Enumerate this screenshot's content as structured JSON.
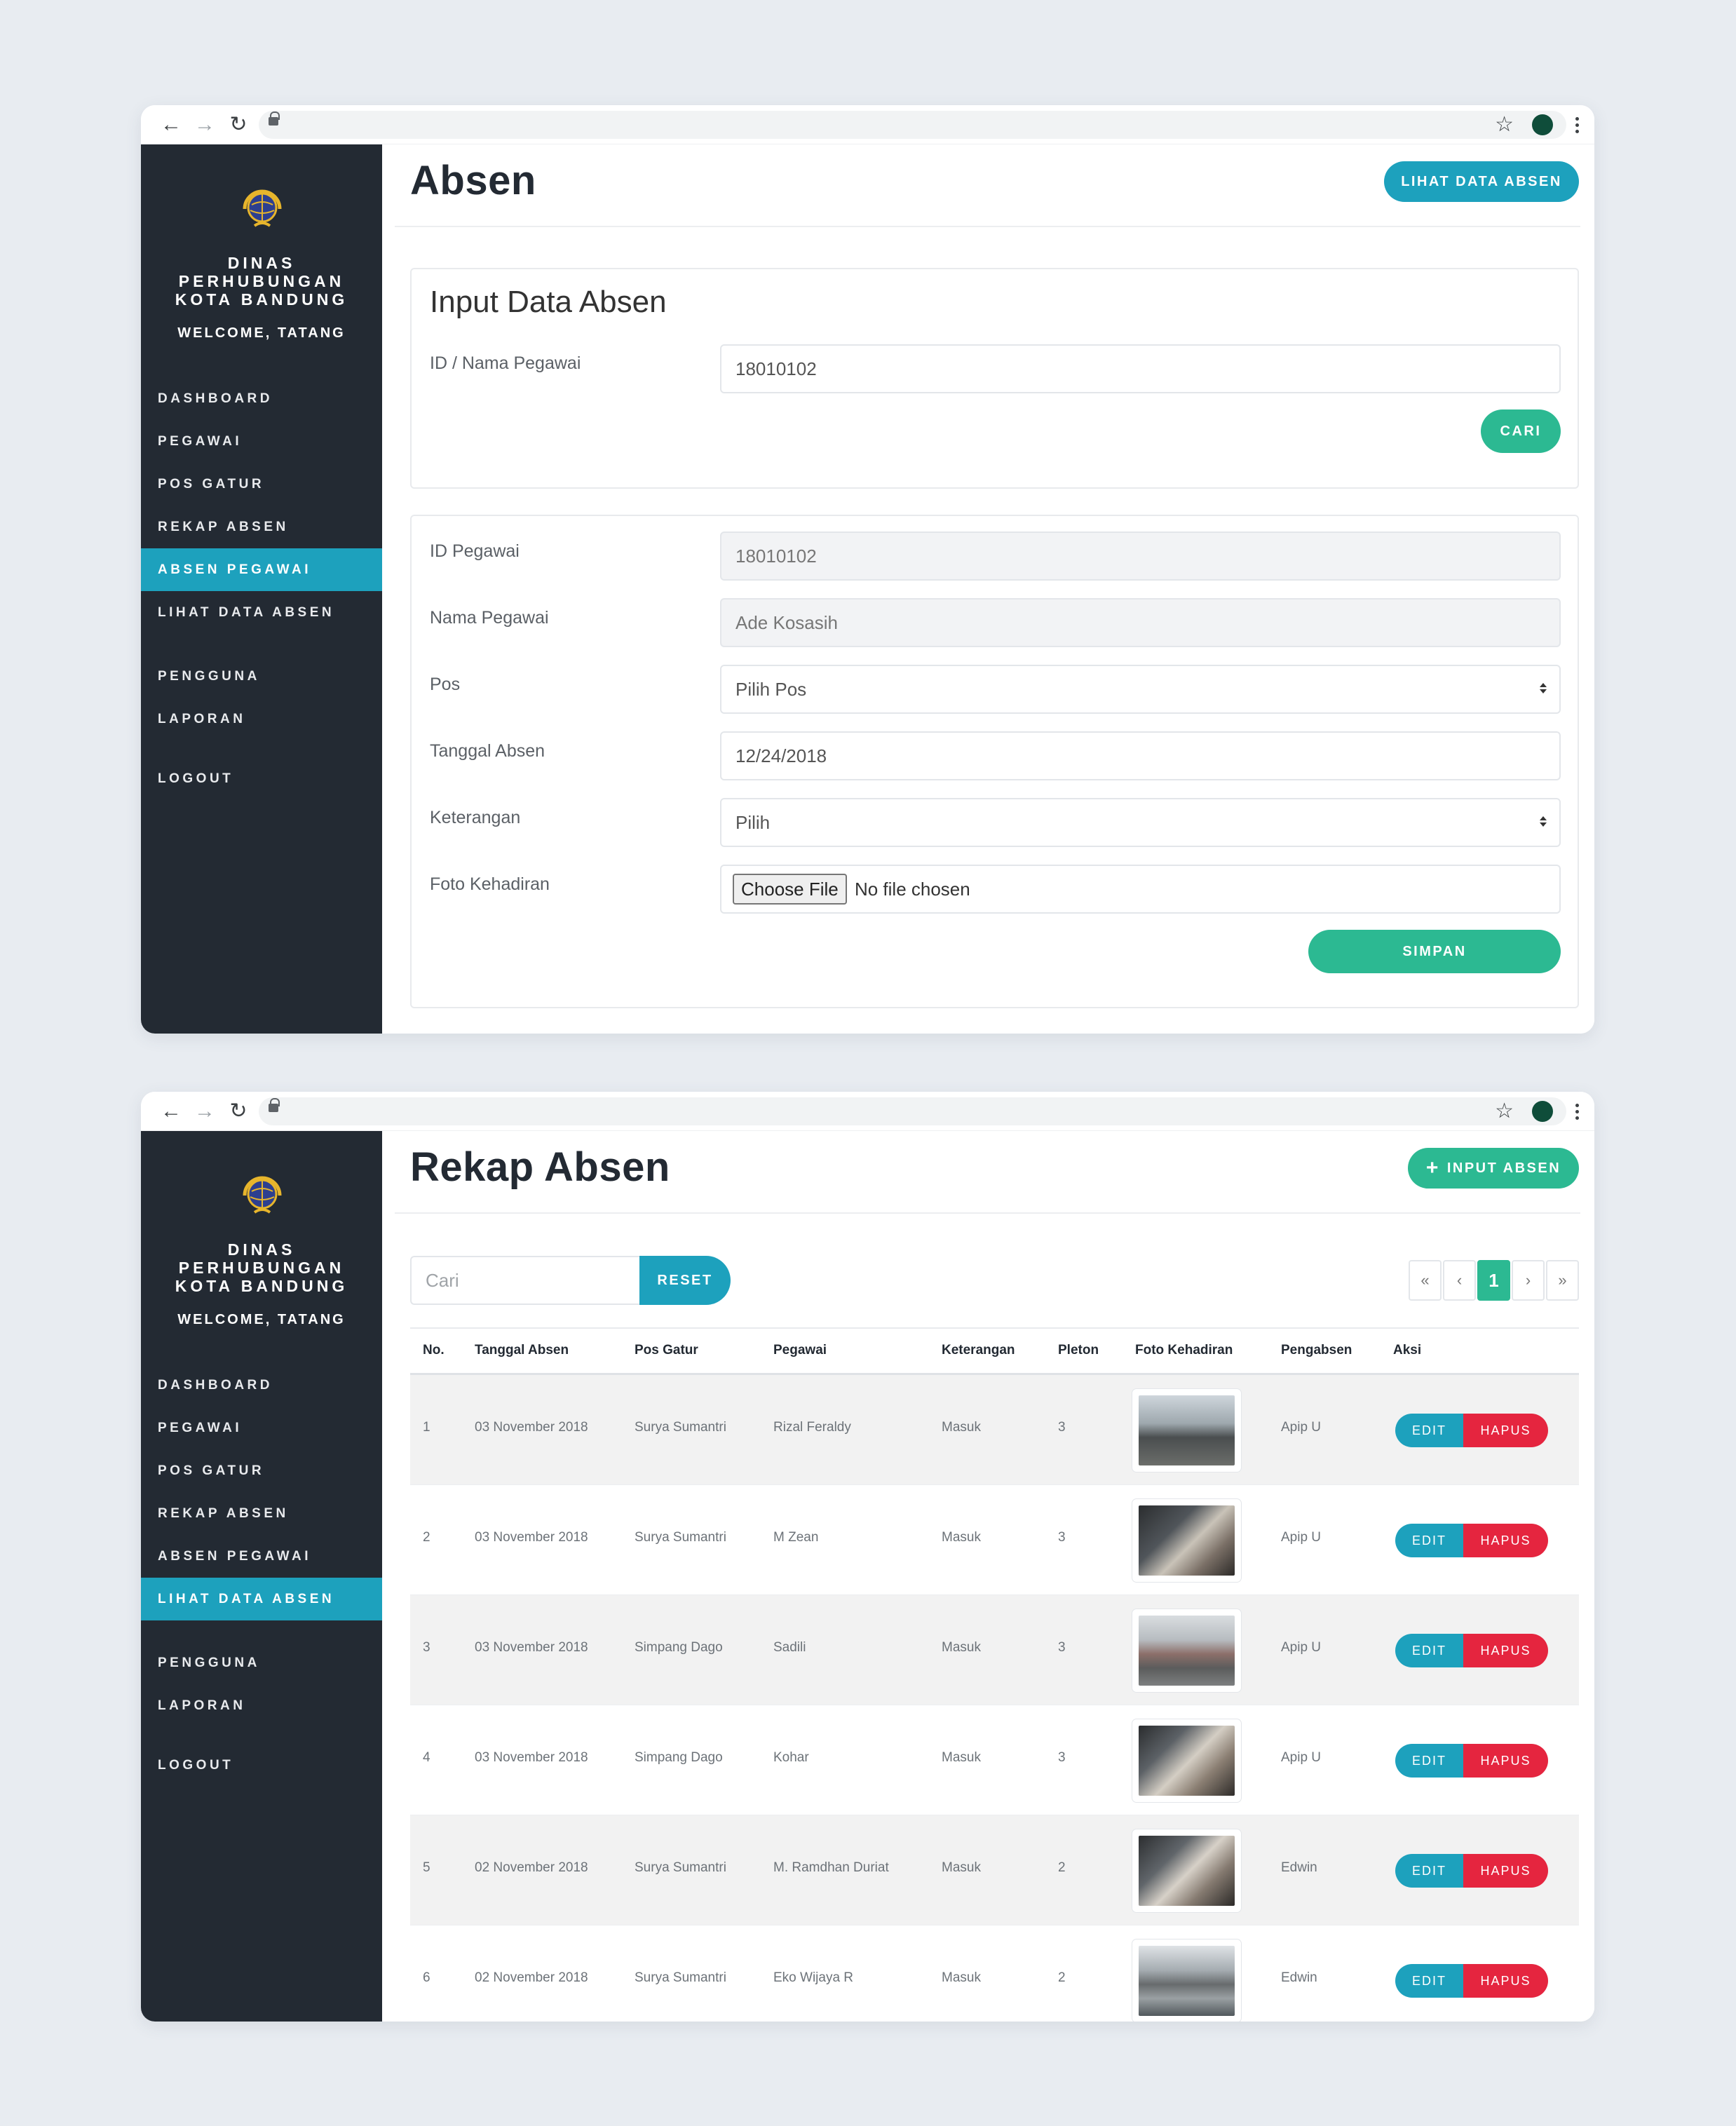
{
  "sidebar": {
    "org_line1": "DINAS",
    "org_line2": "PERHUBUNGAN",
    "org_line3": "KOTA BANDUNG",
    "welcome": "WELCOME, TATANG",
    "items": [
      "DASHBOARD",
      "PEGAWAI",
      "POS GATUR",
      "REKAP ABSEN",
      "ABSEN PEGAWAI",
      "LIHAT DATA ABSEN",
      "PENGGUNA",
      "LAPORAN",
      "LOGOUT"
    ]
  },
  "absen_page": {
    "title": "Absen",
    "top_button": "LIHAT DATA ABSEN",
    "active_menu": "ABSEN PEGAWAI",
    "search_card": {
      "title": "Input Data Absen",
      "label": "ID / Nama Pegawai",
      "value": "18010102",
      "button": "CARI"
    },
    "form": {
      "id_label": "ID Pegawai",
      "id_value": "18010102",
      "nama_label": "Nama Pegawai",
      "nama_value": "Ade Kosasih",
      "pos_label": "Pos",
      "pos_value": "Pilih Pos",
      "tanggal_label": "Tanggal Absen",
      "tanggal_value": "12/24/2018",
      "keterangan_label": "Keterangan",
      "keterangan_value": "Pilih",
      "foto_label": "Foto Kehadiran",
      "file_button": "Choose File",
      "file_status": "No file chosen",
      "submit": "SIMPAN"
    }
  },
  "rekap_page": {
    "title": "Rekap Absen",
    "top_button": "INPUT ABSEN",
    "active_menu": "LIHAT DATA ABSEN",
    "search_placeholder": "Cari",
    "reset": "RESET",
    "pagination": [
      "«",
      "‹",
      "1",
      "›",
      "»"
    ],
    "columns": [
      "No.",
      "Tanggal Absen",
      "Pos Gatur",
      "Pegawai",
      "Keterangan",
      "Pleton",
      "Foto Kehadiran",
      "Pengabsen",
      "Aksi"
    ],
    "rows": [
      {
        "no": "1",
        "tanggal": "03 November 2018",
        "pos": "Surya Sumantri",
        "pegawai": "Rizal Feraldy",
        "keterangan": "Masuk",
        "pleton": "3",
        "pengabsen": "Apip U"
      },
      {
        "no": "2",
        "tanggal": "03 November 2018",
        "pos": "Surya Sumantri",
        "pegawai": "M Zean",
        "keterangan": "Masuk",
        "pleton": "3",
        "pengabsen": "Apip U"
      },
      {
        "no": "3",
        "tanggal": "03 November 2018",
        "pos": "Simpang Dago",
        "pegawai": "Sadili",
        "keterangan": "Masuk",
        "pleton": "3",
        "pengabsen": "Apip U"
      },
      {
        "no": "4",
        "tanggal": "03 November 2018",
        "pos": "Simpang Dago",
        "pegawai": "Kohar",
        "keterangan": "Masuk",
        "pleton": "3",
        "pengabsen": "Apip U"
      },
      {
        "no": "5",
        "tanggal": "02 November 2018",
        "pos": "Surya Sumantri",
        "pegawai": "M. Ramdhan Duriat",
        "keterangan": "Masuk",
        "pleton": "2",
        "pengabsen": "Edwin"
      },
      {
        "no": "6",
        "tanggal": "02 November 2018",
        "pos": "Surya Sumantri",
        "pegawai": "Eko Wijaya R",
        "keterangan": "Masuk",
        "pleton": "2",
        "pengabsen": "Edwin"
      }
    ],
    "edit_label": "EDIT",
    "hapus_label": "HAPUS"
  },
  "colors": {
    "sidebar_bg": "#232a33",
    "accent_blue": "#1da1bd",
    "accent_green": "#2cb992",
    "danger_red": "#e5253f"
  }
}
